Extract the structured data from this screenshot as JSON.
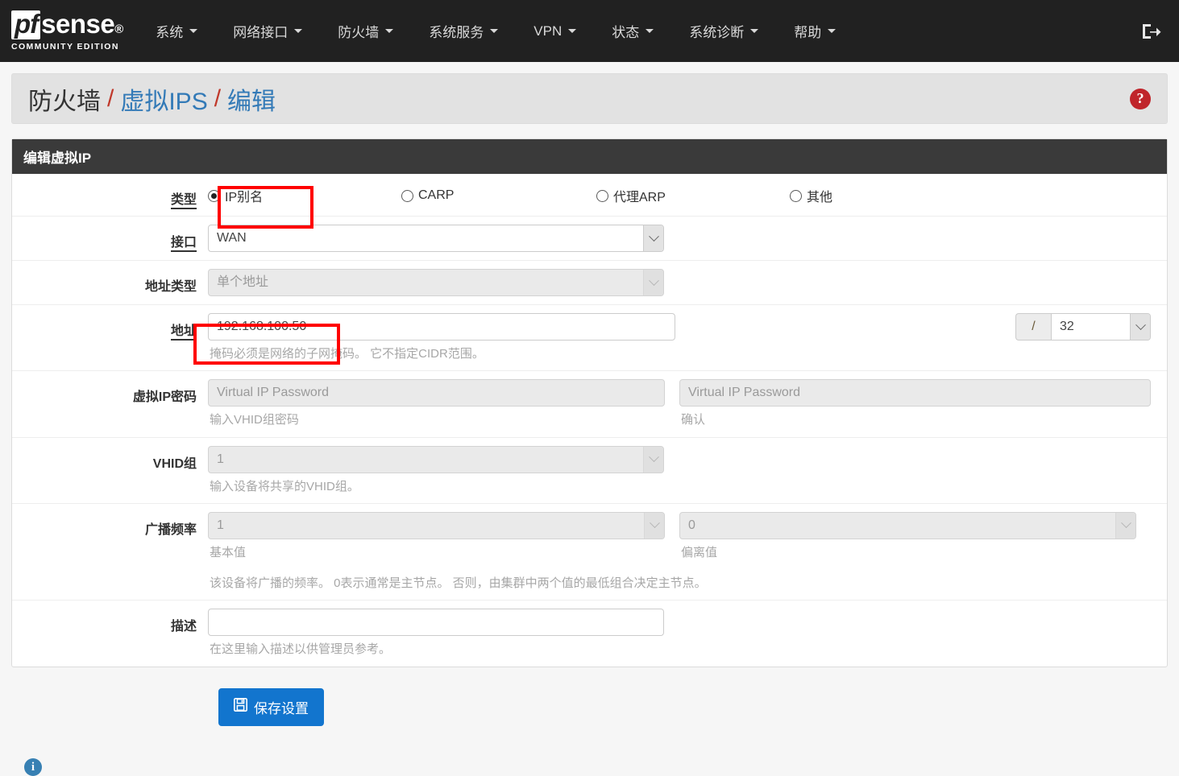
{
  "brand": {
    "name_pf": "pf",
    "name_sense": "sense",
    "registered": "®",
    "subtitle": "COMMUNITY EDITION"
  },
  "nav": {
    "items": [
      {
        "label": "系统",
        "icon": "chevron-down-icon"
      },
      {
        "label": "网络接口",
        "icon": "chevron-down-icon"
      },
      {
        "label": "防火墙",
        "icon": "chevron-down-icon"
      },
      {
        "label": "系统服务",
        "icon": "chevron-down-icon"
      },
      {
        "label": "VPN",
        "icon": "chevron-down-icon"
      },
      {
        "label": "状态",
        "icon": "chevron-down-icon"
      },
      {
        "label": "系统诊断",
        "icon": "chevron-down-icon"
      },
      {
        "label": "帮助",
        "icon": "chevron-down-icon"
      }
    ],
    "logout_icon": "logout-icon"
  },
  "breadcrumb": {
    "part1": "防火墙",
    "sep1": "/",
    "part2": "虚拟IPS",
    "sep2": "/",
    "part3": "编辑",
    "help_icon": "?"
  },
  "panel": {
    "title": "编辑虚拟IP"
  },
  "form": {
    "type": {
      "label": "类型",
      "options": [
        {
          "label": "IP别名",
          "checked": true
        },
        {
          "label": "CARP",
          "checked": false
        },
        {
          "label": "代理ARP",
          "checked": false
        },
        {
          "label": "其他",
          "checked": false
        }
      ]
    },
    "interface": {
      "label": "接口",
      "value": "WAN",
      "disabled": false
    },
    "address_type": {
      "label": "地址类型",
      "value": "单个地址",
      "disabled": true
    },
    "address": {
      "label": "地址",
      "value": "192.168.100.50",
      "placeholder": "",
      "cidr_prefix": "/",
      "cidr_value": "32",
      "help": "掩码必须是网络的子网掩码。 它不指定CIDR范围。"
    },
    "vip_password": {
      "label": "虚拟IP密码",
      "placeholder": "Virtual IP Password",
      "value": "",
      "help_left": "输入VHID组密码",
      "confirm_placeholder": "Virtual IP Password",
      "confirm_value": "",
      "help_right": "确认",
      "disabled": true
    },
    "vhid_group": {
      "label": "VHID组",
      "value": "1",
      "help": "输入设备将共享的VHID组。",
      "disabled": true
    },
    "advertising_frequency": {
      "label": "广播频率",
      "base_value": "1",
      "base_help": "基本值",
      "skew_value": "0",
      "skew_help": "偏离值",
      "help": "该设备将广播的频率。 0表示通常是主节点。 否则，由集群中两个值的最低组合决定主节点。",
      "disabled": true
    },
    "description": {
      "label": "描述",
      "value": "",
      "placeholder": "",
      "help": "在这里输入描述以供管理员参考。"
    }
  },
  "actions": {
    "save_label": "保存设置",
    "save_icon": "save-floppy-icon"
  },
  "footer": {
    "info_icon": "i"
  },
  "annotations": {
    "highlight_color": "#ff0000",
    "boxes": [
      {
        "target": "type-radio-ip-alias"
      },
      {
        "target": "address-input"
      }
    ]
  }
}
